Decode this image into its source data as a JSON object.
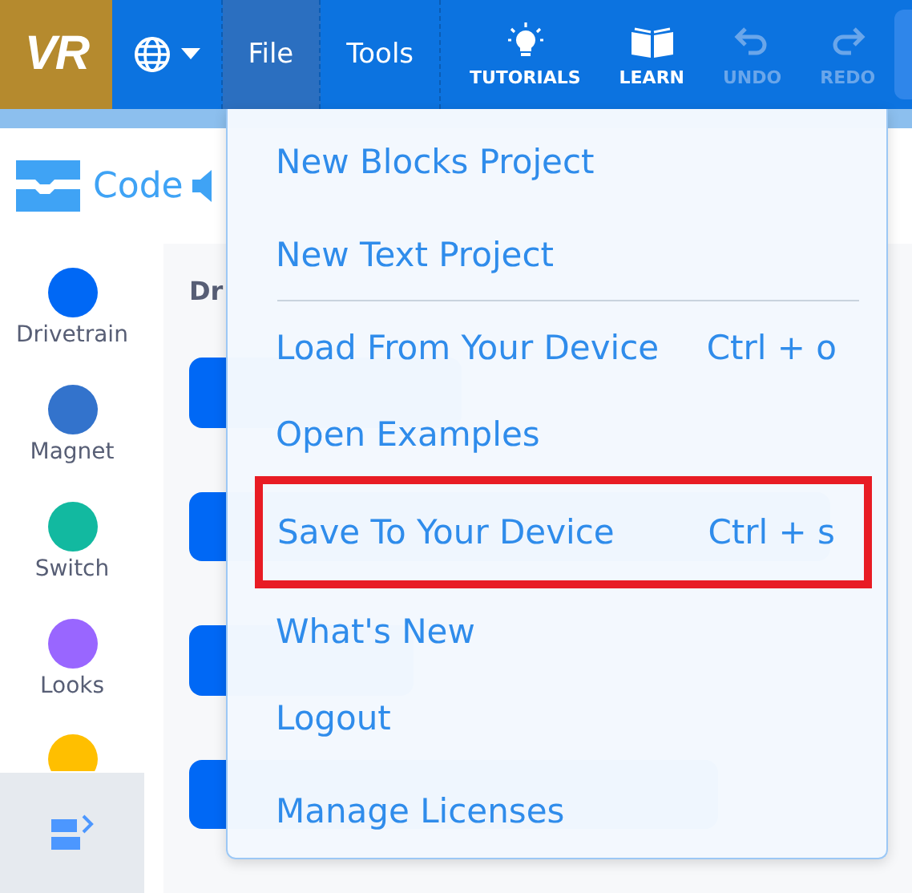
{
  "toolbar": {
    "logo": "VR",
    "menus": [
      {
        "label": "File",
        "selected": true
      },
      {
        "label": "Tools",
        "selected": false
      }
    ],
    "actions": [
      {
        "kind": "tutorials",
        "label": "TUTORIALS",
        "disabled": false
      },
      {
        "kind": "learn",
        "label": "LEARN",
        "disabled": false
      },
      {
        "kind": "undo",
        "label": "UNDO",
        "disabled": true
      },
      {
        "kind": "redo",
        "label": "REDO",
        "disabled": true
      }
    ]
  },
  "code_header": {
    "title": "Code"
  },
  "categories": [
    {
      "name": "Drivetrain",
      "color": "#0068f5"
    },
    {
      "name": "Magnet",
      "color": "#3373cc"
    },
    {
      "name": "Switch",
      "color": "#12b9a0"
    },
    {
      "name": "Looks",
      "color": "#9966ff"
    },
    {
      "color": "#ffbf00"
    }
  ],
  "palette": {
    "heading": "Dr"
  },
  "file_menu": {
    "items": [
      {
        "label": "New Blocks Project",
        "highlighted": false
      },
      {
        "label": "New Text Project",
        "highlighted": false,
        "divider_after": true
      },
      {
        "label": "Load From Your Device",
        "shortcut": "Ctrl + o",
        "highlighted": false
      },
      {
        "label": "Open Examples",
        "highlighted": false
      },
      {
        "label": "Save To Your Device",
        "shortcut": "Ctrl + s",
        "highlighted": true
      },
      {
        "label": "What's New",
        "highlighted": false
      },
      {
        "label": "Logout",
        "highlighted": false
      },
      {
        "label": "Manage Licenses",
        "highlighted": false
      }
    ]
  }
}
